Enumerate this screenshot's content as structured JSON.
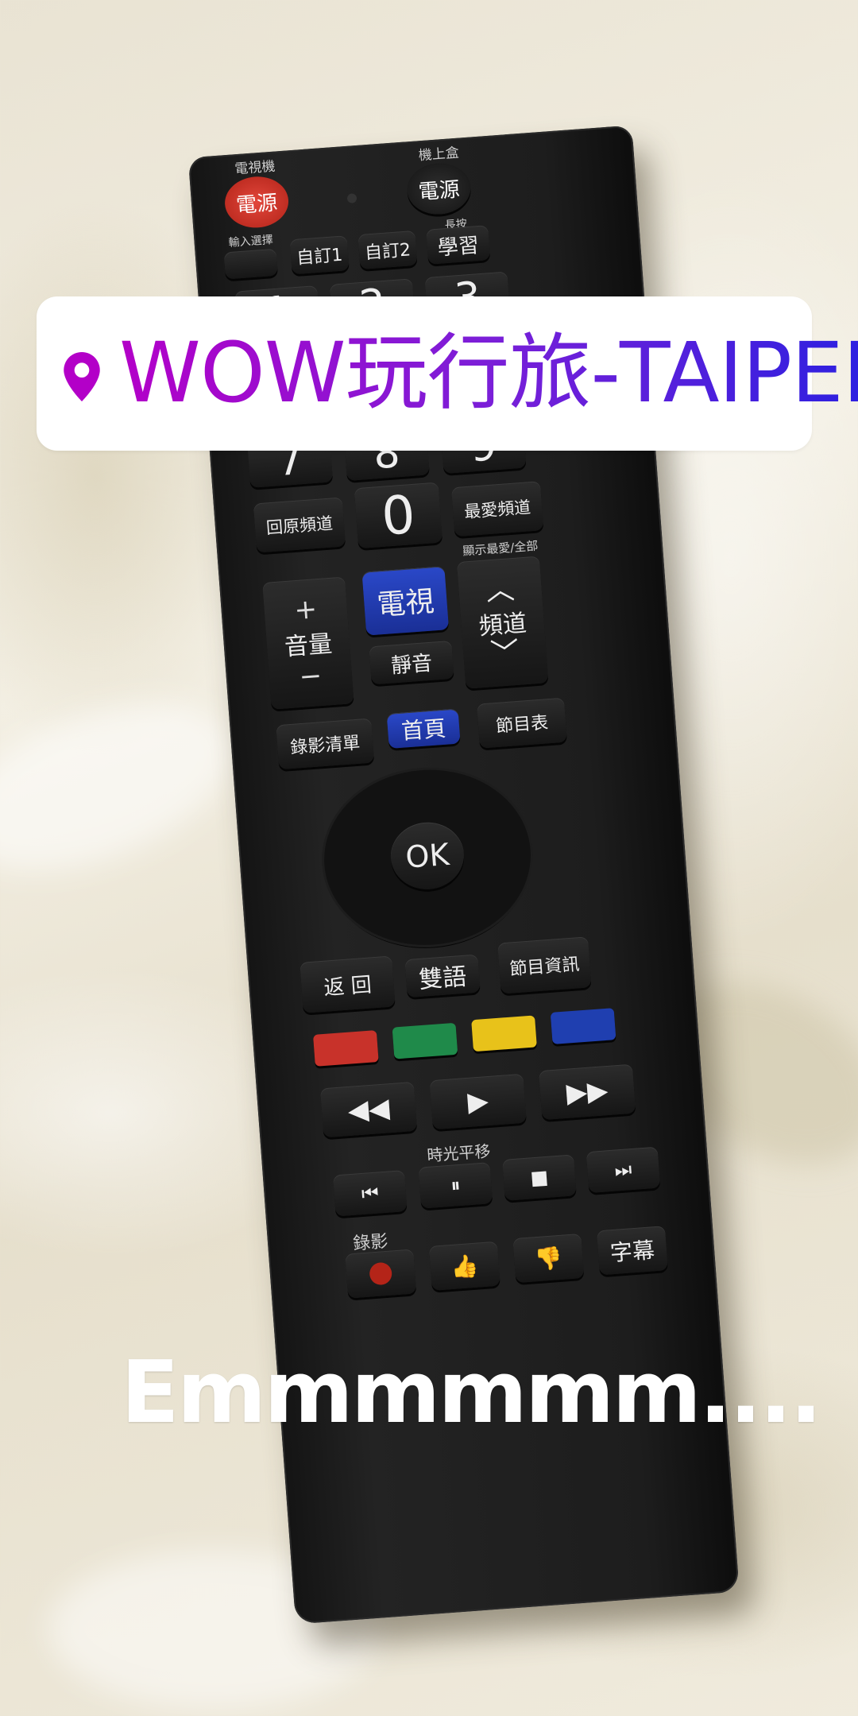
{
  "location_sticker": {
    "text": "WOW玩行旅-TAIPEI",
    "icon": "location-pin-icon",
    "gradient": [
      "#b300c8",
      "#2c20e0"
    ]
  },
  "caption": {
    "text": "Emmmmmm...."
  },
  "remote": {
    "top_labels": {
      "tv": "電視機",
      "stb": "機上盒",
      "input": "輸入選擇",
      "learn_top": "長按"
    },
    "power_tv": "電源",
    "power_stb": "電源",
    "custom1": "自訂1",
    "custom2": "自訂2",
    "learn": "學習",
    "digits_top": [
      "1",
      "2",
      "3"
    ],
    "digits_mid": [
      "7",
      "8",
      "9"
    ],
    "back_channel": "回原頻道",
    "zero": "0",
    "fav_channel": "最愛頻道",
    "fav_note": "顯示最愛/全部",
    "vol_plus": "+",
    "vol_label": "音量",
    "vol_minus": "−",
    "tv": "電視",
    "mute": "靜音",
    "ch_label": "頻道",
    "rec_list": "錄影清單",
    "home": "首頁",
    "guide": "節目表",
    "ok": "OK",
    "back": "返 回",
    "dual_lang": "雙語",
    "info": "節目資訊",
    "timeshift": "時光平移",
    "record_label": "錄影",
    "subtitle": "字幕",
    "color_keys": [
      "#c8322a",
      "#1f8a4a",
      "#e8c21a",
      "#1f3fb0"
    ]
  }
}
